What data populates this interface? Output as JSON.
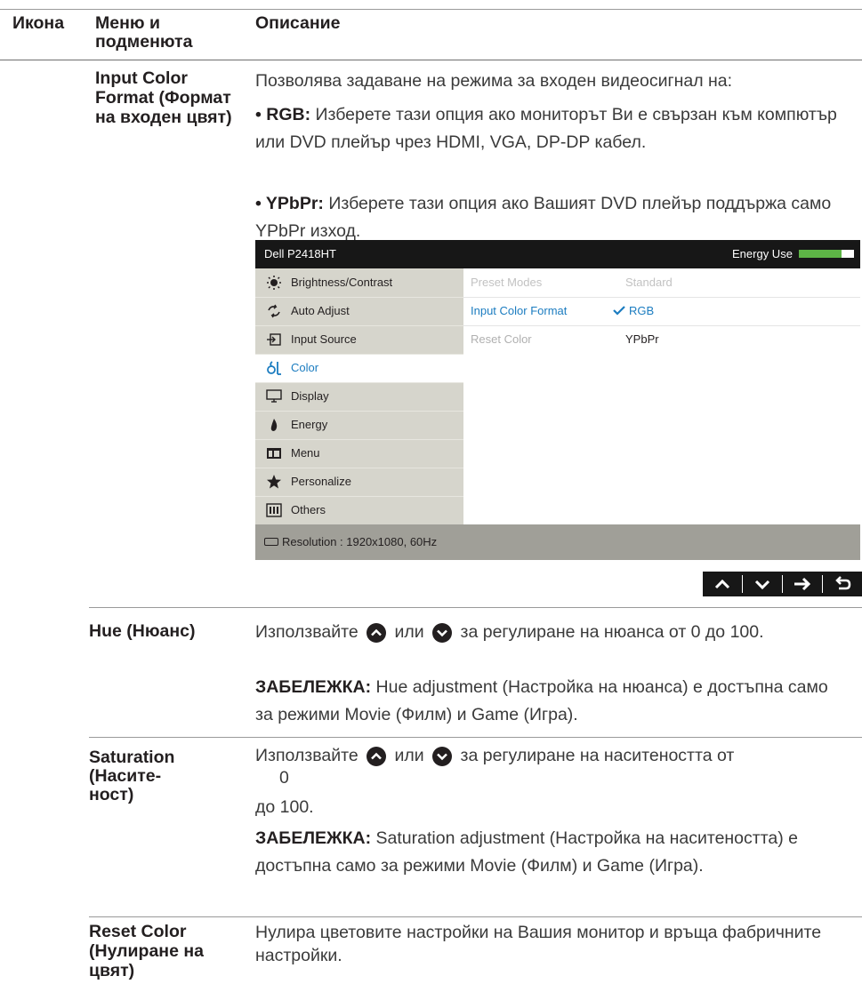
{
  "header": {
    "col_icon": "Икона",
    "col_menu": "Меню и подменюта",
    "col_desc": "Описание"
  },
  "rows": {
    "input_color": {
      "name": "Input Color Format (Формат на входен цвят)",
      "intro": "Позволява задаване на режима за входен видеосигнал на:",
      "rgb_term": "RGB:",
      "rgb_text": " Изберете тази опция ако мониторът Ви е свързан към компютър или DVD плейър чрез HDMI, VGA, DP-DP кабел.",
      "ypbpr_term": "YPbPr:",
      "ypbpr_text": " Изберете тази опция ако Вашият DVD плейър поддържа само YPbPr изход."
    },
    "hue": {
      "name": "Hue (Нюанс)",
      "line1_a": "Използвайте ",
      "line1_b": " или ",
      "line1_c": " за регулиране на нюанса от 0 до 100.",
      "note_term": "ЗАБЕЛЕЖКА:",
      "note_text": " Hue adjustment (Настройка на нюанса) е достъпна само за режими Movie (Филм) и Game (Игра)."
    },
    "saturation": {
      "name": "Saturation (Насите-ност)",
      "line1_a": "Използвайте ",
      "line1_b": " или ",
      "line1_c": " за регулиране на наситеността от",
      "line1_d": "0",
      "line2": "до 100.",
      "note_term": "ЗАБЕЛЕЖКА:",
      "note_text": " Saturation adjustment (Настройка на наситеността) е достъпна само за режими Movie (Филм) и Game (Игра)."
    },
    "reset_color": {
      "name": "Reset Color (Нулиране на цвят)",
      "desc": "Нулира цветовите настройки на Вашия монитор и връща фабричните настройки."
    }
  },
  "osd": {
    "model": "Dell P2418HT",
    "energy_label": "Energy Use",
    "energy_level": 0.78,
    "menu": [
      {
        "label": "Brightness/Contrast",
        "icon": "brightness-icon",
        "selected": false
      },
      {
        "label": "Auto Adjust",
        "icon": "auto-adjust-icon",
        "selected": false
      },
      {
        "label": "Input Source",
        "icon": "input-source-icon",
        "selected": false
      },
      {
        "label": "Color",
        "icon": "color-icon",
        "selected": true
      },
      {
        "label": "Display",
        "icon": "display-icon",
        "selected": false
      },
      {
        "label": "Energy",
        "icon": "energy-icon",
        "selected": false
      },
      {
        "label": "Menu",
        "icon": "menu-icon",
        "selected": false
      },
      {
        "label": "Personalize",
        "icon": "star-icon",
        "selected": false
      },
      {
        "label": "Others",
        "icon": "others-icon",
        "selected": false
      }
    ],
    "submenu": [
      {
        "label": "Preset Modes",
        "value": "Standard"
      },
      {
        "label": "Input Color Format",
        "value": "RGB"
      },
      {
        "label": "Reset Color",
        "value": "YPbPr"
      }
    ],
    "resolution": "Resolution : 1920x1080, 60Hz"
  },
  "nav_buttons": [
    "up-icon",
    "down-icon",
    "right-arrow-icon",
    "back-icon"
  ],
  "colors": {
    "osd_bar": "#171717",
    "osd_menu_bg": "#d6d5cc",
    "osd_footer": "#a09f98",
    "accent_blue": "#1b7cc0",
    "energy_green": "#5db446"
  }
}
